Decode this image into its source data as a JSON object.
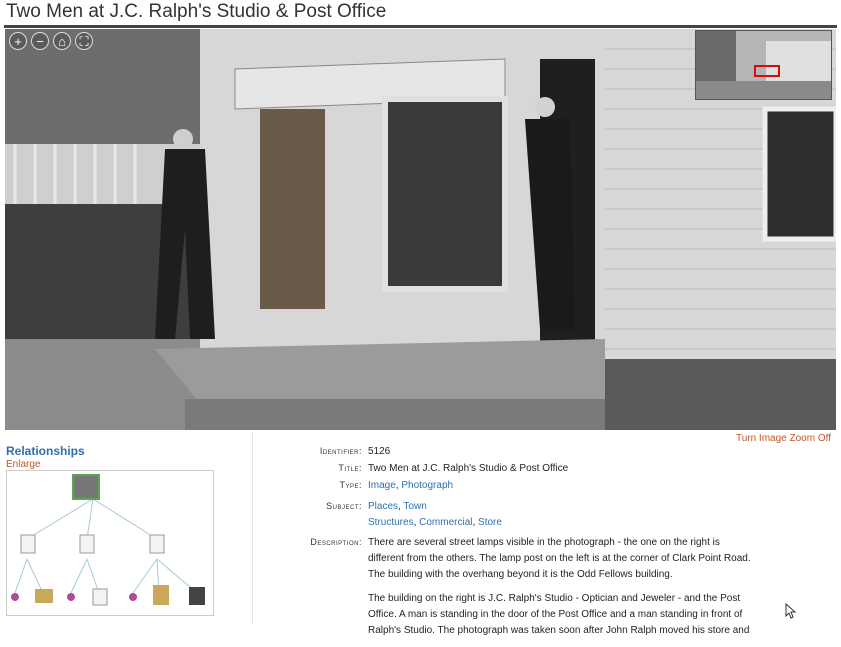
{
  "page": {
    "title": "Two Men at J.C. Ralph's Studio & Post Office"
  },
  "viewer": {
    "controls": [
      {
        "name": "zoom-in",
        "glyph": "+"
      },
      {
        "name": "zoom-out",
        "glyph": "−"
      },
      {
        "name": "home",
        "glyph": "⌂"
      },
      {
        "name": "fullscreen",
        "glyph": "⛶"
      }
    ],
    "turn_zoom_off_label": "Turn Image Zoom Off"
  },
  "relationships": {
    "title": "Relationships",
    "enlarge_label": "Enlarge"
  },
  "metadata": {
    "identifier_label": "Identifier:",
    "identifier": "5126",
    "title_label": "Title:",
    "title": "Two Men at J.C. Ralph's Studio & Post Office",
    "type_label": "Type:",
    "type_values": [
      "Image",
      "Photograph"
    ],
    "subject_label": "Subject:",
    "subject_line1": [
      "Places",
      "Town"
    ],
    "subject_line2": [
      "Structures",
      "Commercial",
      "Store"
    ],
    "description_label": "Description:",
    "description_p1": "There are several street lamps visible in the photograph - the one on the right is different from the others. The lamp post on the left is at the corner of Clark Point Road. The building with the overhang beyond it is the Odd Fellows building.",
    "description_p2": "The building on the right is J.C. Ralph's Studio - Optician and Jeweler - and the Post Office. A man is standing in the door of the Post Office and a man standing in front of Ralph's Studio. The photograph was taken soon after John Ralph moved his store and"
  },
  "colors": {
    "link": "#2f6fb1",
    "accent": "#c0572a",
    "nav_box": "#d01010"
  }
}
